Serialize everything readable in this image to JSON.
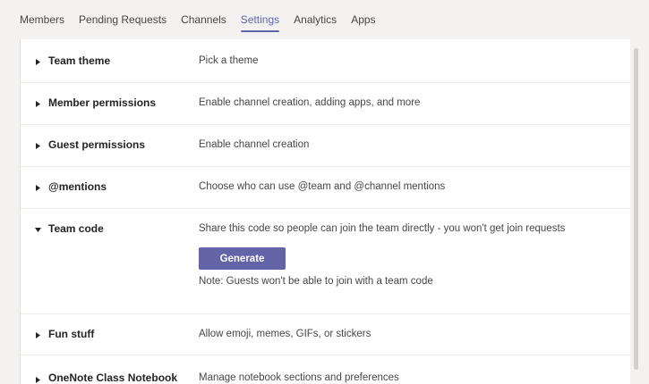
{
  "tabs": [
    {
      "label": "Members"
    },
    {
      "label": "Pending Requests"
    },
    {
      "label": "Channels"
    },
    {
      "label": "Settings",
      "active": true
    },
    {
      "label": "Analytics"
    },
    {
      "label": "Apps"
    }
  ],
  "settings": [
    {
      "title": "Team theme",
      "description": "Pick a theme",
      "expanded": false
    },
    {
      "title": "Member permissions",
      "description": "Enable channel creation, adding apps, and more",
      "expanded": false
    },
    {
      "title": "Guest permissions",
      "description": "Enable channel creation",
      "expanded": false
    },
    {
      "title": "@mentions",
      "description": "Choose who can use @team and @channel mentions",
      "expanded": false
    },
    {
      "title": "Team code",
      "description": "Share this code so people can join the team directly - you won't get join requests",
      "expanded": true,
      "button_label": "Generate",
      "note": "Note: Guests won't be able to join with a team code"
    },
    {
      "title": "Fun stuff",
      "description": "Allow emoji, memes, GIFs, or stickers",
      "expanded": false
    },
    {
      "title": "OneNote Class Notebook",
      "description": "Manage notebook sections and preferences",
      "expanded": false
    }
  ],
  "icons": {
    "collapsed": "caret-right-icon",
    "expanded": "caret-down-icon"
  },
  "colors": {
    "accent": "#6264a7",
    "background": "#f3f2f1",
    "panel": "#ffffff",
    "text": "#252423",
    "muted_text": "#484644"
  }
}
